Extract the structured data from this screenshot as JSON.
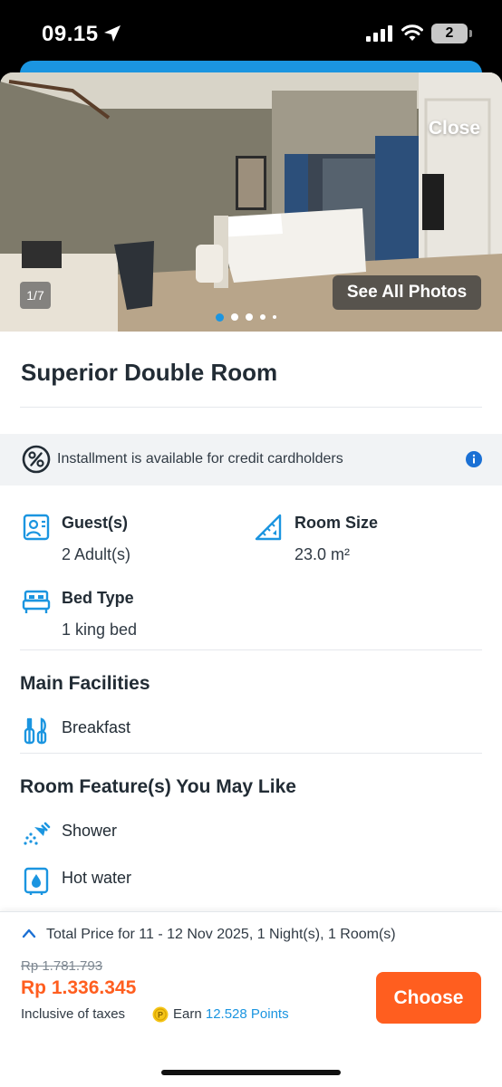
{
  "status_bar": {
    "time": "09.15",
    "battery": "2"
  },
  "gallery": {
    "close_label": "Close",
    "counter": "1/7",
    "see_all_label": "See All Photos",
    "dot_count": 5,
    "active_dot": 0
  },
  "room": {
    "title": "Superior Double Room"
  },
  "installment": {
    "text": "Installment is available for credit cardholders"
  },
  "details": {
    "guests_label": "Guest(s)",
    "guests_value": "2 Adult(s)",
    "size_label": "Room Size",
    "size_value": "23.0 m²",
    "bed_label": "Bed Type",
    "bed_value": "1 king bed"
  },
  "main_facilities": {
    "title": "Main Facilities",
    "items": [
      "Breakfast"
    ]
  },
  "room_features": {
    "title": "Room Feature(s) You May Like",
    "items": [
      "Shower",
      "Hot water"
    ]
  },
  "price": {
    "total_label": "Total Price for 11 - 12 Nov 2025, 1 Night(s), 1 Room(s)",
    "original": "Rp 1.781.793",
    "final": "Rp 1.336.345",
    "tax_note": "Inclusive of taxes",
    "earn_label": "Earn",
    "points": "12.528 Points",
    "choose_label": "Choose"
  },
  "colors": {
    "accent": "#1b95e0",
    "cta": "#ff5e1f"
  }
}
